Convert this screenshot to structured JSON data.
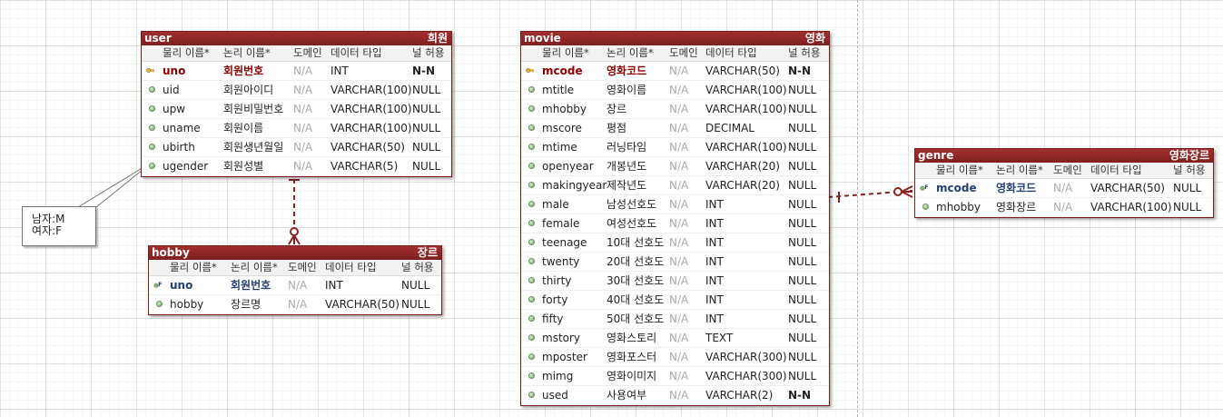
{
  "column_headers": {
    "physical": "물리 이름*",
    "logical": "논리 이름*",
    "domain": "도메인",
    "datatype": "데이터 타입",
    "nullable": "널 허용"
  },
  "user": {
    "name": "user",
    "logical": "회원",
    "rows": [
      {
        "p": "uno",
        "l": "회원번호",
        "d": "N/A",
        "t": "INT",
        "n": "N-N"
      },
      {
        "p": "uid",
        "l": "회원아이디",
        "d": "N/A",
        "t": "VARCHAR(100)",
        "n": "NULL"
      },
      {
        "p": "upw",
        "l": "회원비밀번호",
        "d": "N/A",
        "t": "VARCHAR(100)",
        "n": "NULL"
      },
      {
        "p": "uname",
        "l": "회원이름",
        "d": "N/A",
        "t": "VARCHAR(100)",
        "n": "NULL"
      },
      {
        "p": "ubirth",
        "l": "회원생년월일",
        "d": "N/A",
        "t": "VARCHAR(50)",
        "n": "NULL"
      },
      {
        "p": "ugender",
        "l": "회원성별",
        "d": "N/A",
        "t": "VARCHAR(5)",
        "n": "NULL"
      }
    ]
  },
  "hobby": {
    "name": "hobby",
    "logical": "장르",
    "rows": [
      {
        "p": "uno",
        "l": "회원번호",
        "d": "N/A",
        "t": "INT",
        "n": "NULL"
      },
      {
        "p": "hobby",
        "l": "장르명",
        "d": "N/A",
        "t": "VARCHAR(50)",
        "n": "NULL"
      }
    ]
  },
  "movie": {
    "name": "movie",
    "logical": "영화",
    "rows": [
      {
        "p": "mcode",
        "l": "영화코드",
        "d": "N/A",
        "t": "VARCHAR(50)",
        "n": "N-N"
      },
      {
        "p": "mtitle",
        "l": "영화이름",
        "d": "N/A",
        "t": "VARCHAR(100)",
        "n": "NULL"
      },
      {
        "p": "mhobby",
        "l": "장르",
        "d": "N/A",
        "t": "VARCHAR(100)",
        "n": "NULL"
      },
      {
        "p": "mscore",
        "l": "평점",
        "d": "N/A",
        "t": "DECIMAL",
        "n": "NULL"
      },
      {
        "p": "mtime",
        "l": "러닝타임",
        "d": "N/A",
        "t": "VARCHAR(100)",
        "n": "NULL"
      },
      {
        "p": "openyear",
        "l": "개봉년도",
        "d": "N/A",
        "t": "VARCHAR(20)",
        "n": "NULL"
      },
      {
        "p": "makingyear",
        "l": "제작년도",
        "d": "N/A",
        "t": "VARCHAR(20)",
        "n": "NULL"
      },
      {
        "p": "male",
        "l": "남성선호도",
        "d": "N/A",
        "t": "INT",
        "n": "NULL"
      },
      {
        "p": "female",
        "l": "여성선호도",
        "d": "N/A",
        "t": "INT",
        "n": "NULL"
      },
      {
        "p": "teenage",
        "l": "10대 선호도",
        "d": "N/A",
        "t": "INT",
        "n": "NULL"
      },
      {
        "p": "twenty",
        "l": "20대 선호도",
        "d": "N/A",
        "t": "INT",
        "n": "NULL"
      },
      {
        "p": "thirty",
        "l": "30대 선호도",
        "d": "N/A",
        "t": "INT",
        "n": "NULL"
      },
      {
        "p": "forty",
        "l": "40대 선호도",
        "d": "N/A",
        "t": "INT",
        "n": "NULL"
      },
      {
        "p": "fifty",
        "l": "50대 선호도",
        "d": "N/A",
        "t": "INT",
        "n": "NULL"
      },
      {
        "p": "mstory",
        "l": "영화스토리",
        "d": "N/A",
        "t": "TEXT",
        "n": "NULL"
      },
      {
        "p": "mposter",
        "l": "영화포스터",
        "d": "N/A",
        "t": "VARCHAR(300)",
        "n": "NULL"
      },
      {
        "p": "mimg",
        "l": "영화이미지",
        "d": "N/A",
        "t": "VARCHAR(300)",
        "n": "NULL"
      },
      {
        "p": "used",
        "l": "사용여부",
        "d": "N/A",
        "t": "VARCHAR(2)",
        "n": "N-N"
      }
    ]
  },
  "genre": {
    "name": "genre",
    "logical": "영화장르",
    "rows": [
      {
        "p": "mcode",
        "l": "영화코드",
        "d": "N/A",
        "t": "VARCHAR(50)",
        "n": "NULL"
      },
      {
        "p": "mhobby",
        "l": "영화장르",
        "d": "N/A",
        "t": "VARCHAR(100)",
        "n": "NULL"
      }
    ]
  },
  "note": {
    "line1": "남자:M",
    "line2": "여자:F"
  },
  "colors": {
    "header": "#8b2222",
    "pk_text": "#8b0000",
    "fk_text": "#233f73",
    "relationship": "#8b2222"
  }
}
